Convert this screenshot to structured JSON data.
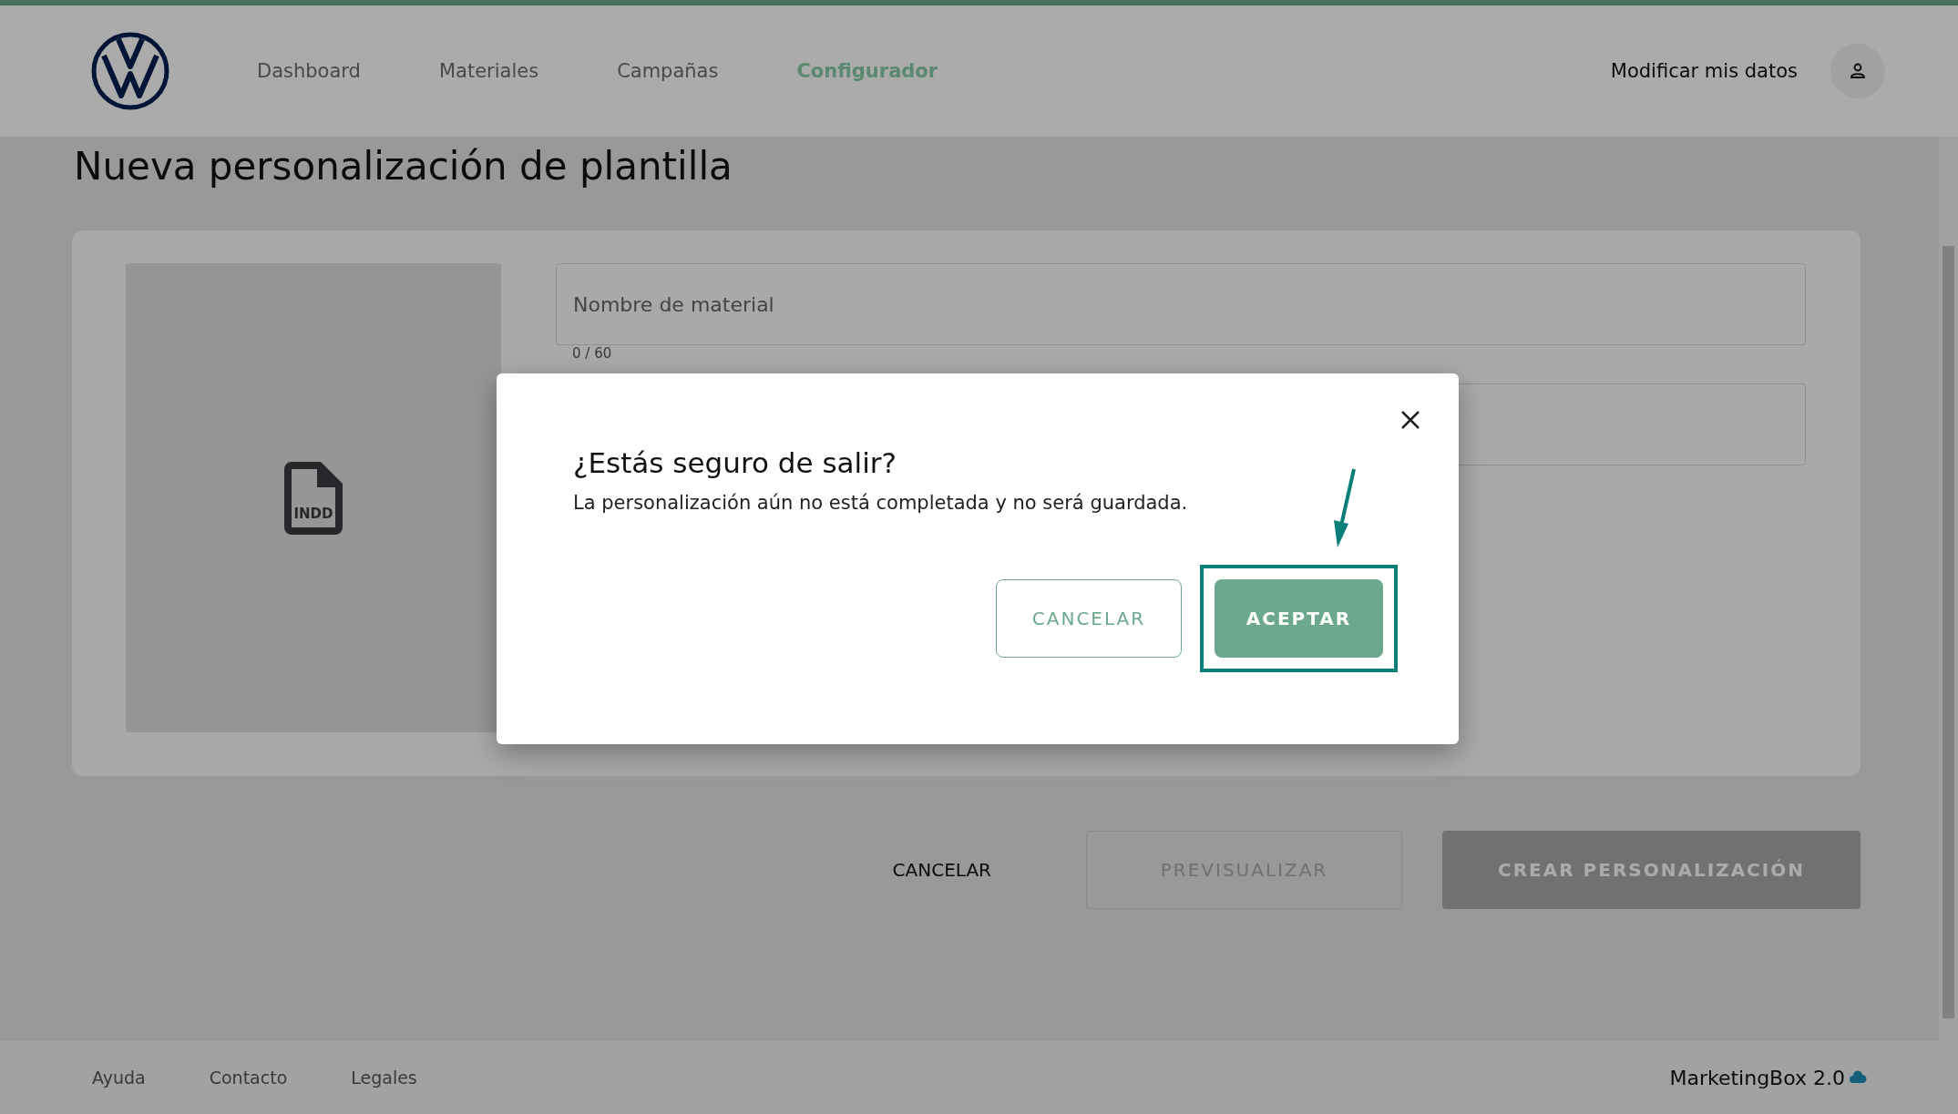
{
  "header": {
    "nav": [
      {
        "label": "Dashboard",
        "selected": false
      },
      {
        "label": "Materiales",
        "selected": false
      },
      {
        "label": "Campañas",
        "selected": false
      },
      {
        "label": "Configurador",
        "selected": true
      }
    ],
    "account_link": "Modificar mis datos"
  },
  "page": {
    "title": "Nueva personalización de plantilla",
    "preview": {
      "file_type": "INDD"
    },
    "fields": [
      {
        "placeholder": "Nombre de material",
        "counter": "0 / 60"
      }
    ],
    "actions": [
      {
        "label": "CANCELAR",
        "kind": "text",
        "disabled": false
      },
      {
        "label": "PREVISUALIZAR",
        "kind": "outline",
        "disabled": true
      },
      {
        "label": "CREAR PERSONALIZACIÓN",
        "kind": "filled",
        "disabled": true
      }
    ]
  },
  "footer": {
    "links": [
      "Ayuda",
      "Contacto",
      "Legales"
    ],
    "brand": "MarketingBox 2.0"
  },
  "dialog": {
    "title": "¿Estás seguro de salir?",
    "message": "La personalización aún no está completada y no será guardada.",
    "buttons": [
      {
        "label": "CANCELAR",
        "kind": "outline",
        "highlighted": false
      },
      {
        "label": "ACEPTAR",
        "kind": "filled",
        "highlighted": true
      }
    ]
  }
}
